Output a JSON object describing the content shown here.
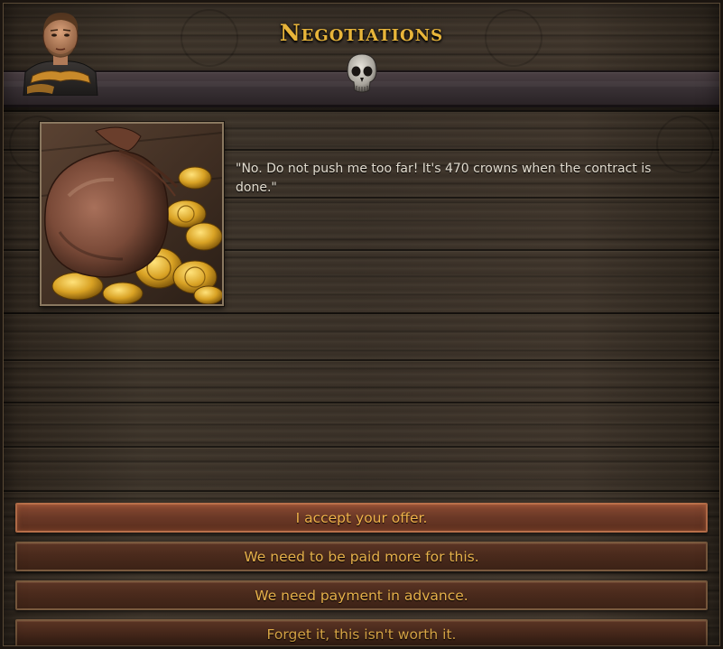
{
  "header": {
    "title": "Negotiations",
    "portrait_icon": "character-portrait",
    "skull_icon": "skull-icon"
  },
  "event": {
    "image": "coin-purse-image",
    "text": "\"No. Do not push me too far! It's 470 crowns when the contract is done.\""
  },
  "options": [
    {
      "label": "I accept your offer.",
      "state": "hover"
    },
    {
      "label": "We need to be paid more for this.",
      "state": "normal"
    },
    {
      "label": "We need payment in advance.",
      "state": "normal"
    },
    {
      "label": "Forget it, this isn't worth it.",
      "state": "normal"
    }
  ],
  "colors": {
    "title": "#e8b53a",
    "button_text": "#e6b04a",
    "body_text": "#e2dccf",
    "button_bg": "#4a2a1c",
    "button_hover_bg": "#6a3826"
  }
}
